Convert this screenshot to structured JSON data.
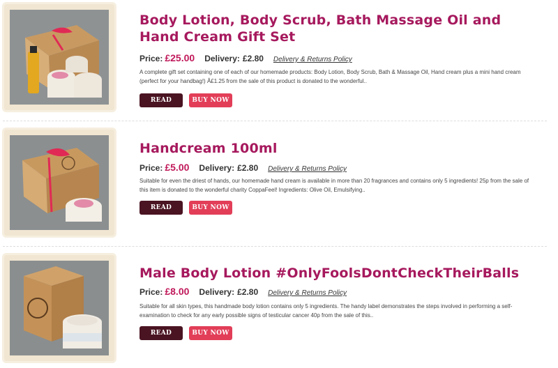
{
  "products": [
    {
      "title": "Body Lotion, Body Scrub, Bath Massage Oil and Hand Cream Gift Set",
      "price_label": "Price:",
      "price": "£25.00",
      "delivery_label": "Delivery:",
      "delivery": "£2.80",
      "policy_link": "Delivery & Returns Policy",
      "description": "A complete gift set containing one of each of our homemade products: Body Lotion, Body Scrub, Bath & Massage Oil, Hand cream plus a mini hand cream (perfect for your handbag!) Â£1.25 from the sale of this product is donated to the wonderful..",
      "read_more": "READ MORE",
      "buy_now": "BUY NOW"
    },
    {
      "title": "Handcream 100ml",
      "price_label": "Price:",
      "price": "£5.00",
      "delivery_label": "Delivery:",
      "delivery": "£2.80",
      "policy_link": "Delivery & Returns Policy",
      "description": "Suitable for even the driest of hands, our homemade hand cream is available in more than 20 fragrances and contains only 5 ingredients! 25p from the sale of this item is donated to the wonderful charity CoppaFeel! Ingredients: Olive Oil, Emulsifying..",
      "read_more": "READ MORE",
      "buy_now": "BUY NOW"
    },
    {
      "title": "Male Body Lotion #OnlyFoolsDontCheckTheirBalls",
      "price_label": "Price:",
      "price": "£8.00",
      "delivery_label": "Delivery:",
      "delivery": "£2.80",
      "policy_link": "Delivery & Returns Policy",
      "description": "Suitable for all skin types, this handmade body lotion contains only 5 ingredients. The handy label demonstrates the steps involved in performing a self-examination to check for any early possible signs of testicular cancer 40p from the sale of this..",
      "read_more": "READ MORE",
      "buy_now": "BUY NOW"
    }
  ],
  "colors": {
    "title": "#a6195d",
    "price": "#c0195a",
    "read_more_bg": "#4a1422",
    "buy_now_bg": "#e23e58"
  }
}
